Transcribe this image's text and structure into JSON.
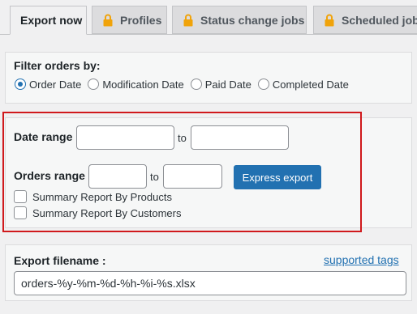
{
  "tabs": [
    {
      "label": "Export now",
      "locked": false,
      "active": true
    },
    {
      "label": "Profiles",
      "locked": true
    },
    {
      "label": "Status change jobs",
      "locked": true
    },
    {
      "label": "Scheduled jobs",
      "locked": true
    }
  ],
  "filter": {
    "title": "Filter orders by:",
    "options": [
      "Order Date",
      "Modification Date",
      "Paid Date",
      "Completed Date"
    ],
    "selected": "Order Date"
  },
  "date_range": {
    "label": "Date range",
    "to": "to",
    "from_value": "",
    "to_value": ""
  },
  "orders_range": {
    "label": "Orders range",
    "to": "to",
    "from_value": "",
    "to_value": ""
  },
  "express_export_label": "Express export",
  "checkboxes": [
    {
      "label": "Summary Report By Products",
      "checked": false
    },
    {
      "label": "Summary Report By Customers",
      "checked": false
    }
  ],
  "filename": {
    "label": "Export filename :",
    "link": "supported tags",
    "value": "orders-%y-%m-%d-%h-%i-%s.xlsx"
  },
  "colors": {
    "accent": "#2271b1",
    "lock": "#f0a30a",
    "highlight": "#d0191c"
  }
}
